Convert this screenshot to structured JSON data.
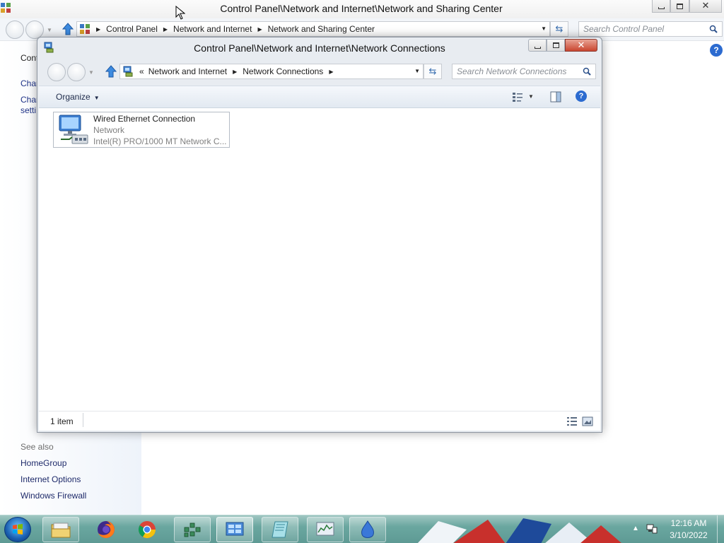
{
  "bg_window": {
    "title": "Control Panel\\Network and Internet\\Network and Sharing Center",
    "breadcrumbs": [
      "Control Panel",
      "Network and Internet",
      "Network and Sharing Center"
    ],
    "search_placeholder": "Search Control Panel",
    "sidebar": {
      "partial_items": [
        "Cont",
        "Chan",
        "Chan",
        "setti"
      ],
      "see_also_label": "See also",
      "links": [
        "HomeGroup",
        "Internet Options",
        "Windows Firewall"
      ]
    },
    "help_glyph": "?"
  },
  "fg_window": {
    "title": "Control Panel\\Network and Internet\\Network Connections",
    "overflow_chevron": "«",
    "breadcrumbs": [
      "Network and Internet",
      "Network Connections"
    ],
    "search_placeholder": "Search Network Connections",
    "toolbar": {
      "organize_label": "Organize"
    },
    "connections": [
      {
        "name": "Wired Ethernet Connection",
        "status": "Network",
        "device": "Intel(R) PRO/1000 MT Network C..."
      }
    ],
    "status_bar": {
      "item_count": "1 item"
    }
  },
  "taskbar": {
    "apps": [
      "windows-explorer",
      "firefox",
      "chrome",
      "network-connections",
      "control-panel",
      "notepad",
      "task-manager",
      "app-blue-drop"
    ],
    "time": "12:16 AM",
    "date": "3/10/2022"
  },
  "colors": {
    "link_blue": "#1e3287",
    "taskbar_teal": "#6aa7a0",
    "help_blue": "#2c6bd0"
  }
}
